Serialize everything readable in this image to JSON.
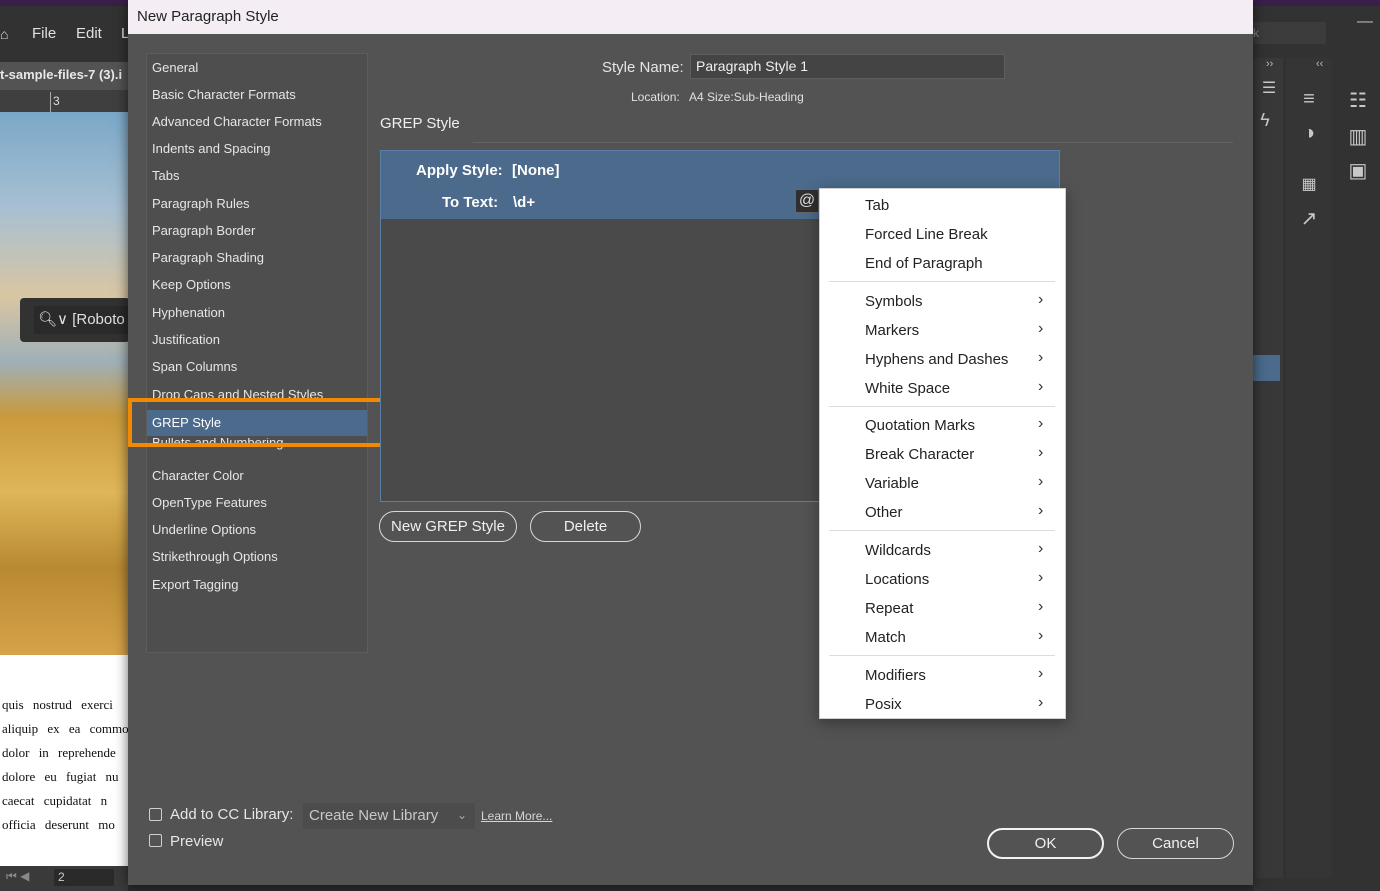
{
  "app": {
    "menu": {
      "file": "File",
      "edit": "Edit",
      "cut": "L"
    },
    "search_partial": "k",
    "document_tab": "t-sample-files-7 (3).i",
    "ruler_mark": "3",
    "font_field": "[Roboto S",
    "page_number": "2",
    "canvas_text_lines": [
      "quis nostrud exerci",
      "aliquip ex ea commo",
      "dolor in reprehende",
      "dolore eu fugiat nu",
      "caecat cupidatat n",
      "officia deserunt mo"
    ]
  },
  "dialog": {
    "title": "New Paragraph Style",
    "categories": [
      "General",
      "Basic Character Formats",
      "Advanced Character Formats",
      "Indents and Spacing",
      "Tabs",
      "Paragraph Rules",
      "Paragraph Border",
      "Paragraph Shading",
      "Keep Options",
      "Hyphenation",
      "Justification",
      "Span Columns",
      "Drop Caps and Nested Styles",
      "GREP Style",
      "Bullets and Numbering",
      "Character Color",
      "OpenType Features",
      "Underline Options",
      "Strikethrough Options",
      "Export Tagging"
    ],
    "selected_category": "GREP Style",
    "style_name_label": "Style Name:",
    "style_name_value": "Paragraph Style 1",
    "location_label": "Location:",
    "location_value": "A4 Size:Sub-Heading",
    "section_heading": "GREP Style",
    "grep_rule": {
      "apply_style_label": "Apply Style:",
      "apply_style_value": "[None]",
      "to_text_label": "To Text:",
      "to_text_value": "\\d+",
      "special_char_button": "@"
    },
    "buttons": {
      "new_grep": "New GREP Style",
      "delete": "Delete",
      "ok": "OK",
      "cancel": "Cancel"
    },
    "cc_library": {
      "label": "Add to CC Library:",
      "select_value": "Create New Library",
      "learn_more": "Learn More..."
    },
    "preview_label": "Preview"
  },
  "context_menu": {
    "groups": [
      [
        {
          "label": "Tab",
          "submenu": false
        },
        {
          "label": "Forced Line Break",
          "submenu": false
        },
        {
          "label": "End of Paragraph",
          "submenu": false
        }
      ],
      [
        {
          "label": "Symbols",
          "submenu": true
        },
        {
          "label": "Markers",
          "submenu": true
        },
        {
          "label": "Hyphens and Dashes",
          "submenu": true
        },
        {
          "label": "White Space",
          "submenu": true
        }
      ],
      [
        {
          "label": "Quotation Marks",
          "submenu": true
        },
        {
          "label": "Break Character",
          "submenu": true
        },
        {
          "label": "Variable",
          "submenu": true
        },
        {
          "label": "Other",
          "submenu": true
        }
      ],
      [
        {
          "label": "Wildcards",
          "submenu": true
        },
        {
          "label": "Locations",
          "submenu": true
        },
        {
          "label": "Repeat",
          "submenu": true
        },
        {
          "label": "Match",
          "submenu": true
        }
      ],
      [
        {
          "label": "Modifiers",
          "submenu": true
        },
        {
          "label": "Posix",
          "submenu": true
        }
      ]
    ]
  },
  "colors": {
    "dialog_bg": "#535353",
    "selection": "#4b6a8c",
    "highlight_annotation": "#f08a00",
    "menu_bg": "#ffffff"
  }
}
